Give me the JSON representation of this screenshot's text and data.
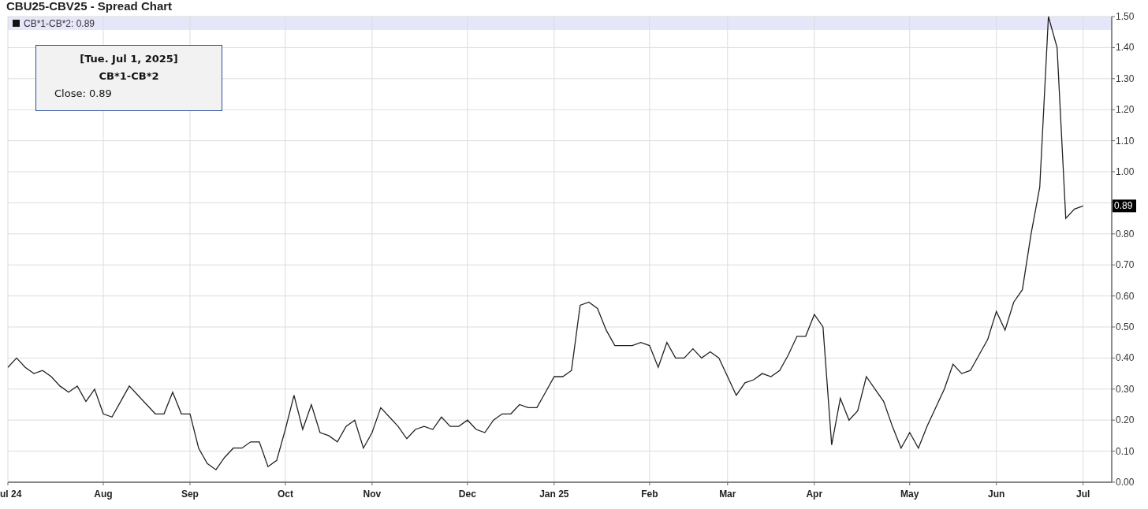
{
  "title": "CBU25-CBV25 - Spread Chart",
  "legend": {
    "label": "CB*1-CB*2: 0.89"
  },
  "tooltip": {
    "date": "[Tue. Jul 1, 2025]",
    "close": "Close: 0.89"
  },
  "last_value": "0.89",
  "chart_data": {
    "type": "line",
    "ylim": [
      0,
      1.5
    ],
    "grid": true,
    "categories": [
      "ul 24",
      null,
      null,
      null,
      null,
      null,
      null,
      null,
      null,
      null,
      null,
      "Aug",
      null,
      null,
      null,
      null,
      null,
      null,
      null,
      null,
      null,
      "Sep",
      null,
      null,
      null,
      null,
      null,
      null,
      null,
      null,
      null,
      null,
      "Oct",
      null,
      null,
      null,
      null,
      null,
      null,
      null,
      null,
      null,
      "Nov",
      null,
      null,
      null,
      null,
      null,
      null,
      null,
      null,
      null,
      null,
      "Dec",
      null,
      null,
      null,
      null,
      null,
      null,
      null,
      null,
      null,
      "Jan 25",
      null,
      null,
      null,
      null,
      null,
      null,
      null,
      null,
      null,
      null,
      "Feb",
      null,
      null,
      null,
      null,
      null,
      null,
      null,
      null,
      "Mar",
      null,
      null,
      null,
      null,
      null,
      null,
      null,
      null,
      null,
      "Apr",
      null,
      null,
      null,
      null,
      null,
      null,
      null,
      null,
      null,
      null,
      "May",
      null,
      null,
      null,
      null,
      null,
      null,
      null,
      null,
      null,
      "Jun",
      null,
      null,
      null,
      null,
      null,
      null,
      null,
      null,
      null,
      "Jul"
    ],
    "yticks": [
      {
        "value": 0,
        "label": "0.00"
      },
      {
        "value": 0.1,
        "label": "0.10"
      },
      {
        "value": 0.2,
        "label": "0.20"
      },
      {
        "value": 0.3,
        "label": "0.30"
      },
      {
        "value": 0.4,
        "label": "0.40"
      },
      {
        "value": 0.5,
        "label": "0.50"
      },
      {
        "value": 0.6,
        "label": "0.60"
      },
      {
        "value": 0.7,
        "label": "0.70"
      },
      {
        "value": 0.8,
        "label": "0.80"
      },
      {
        "value": 1.0,
        "label": "1.00"
      },
      {
        "value": 1.1,
        "label": "1.10"
      },
      {
        "value": 1.2,
        "label": "1.20"
      },
      {
        "value": 1.3,
        "label": "1.30"
      },
      {
        "value": 1.4,
        "label": "1.40"
      },
      {
        "value": 1.5,
        "label": "1.50"
      }
    ],
    "series": [
      {
        "name": "CB*1-CB*2",
        "color": "#222222",
        "values": [
          0.37,
          0.4,
          0.37,
          0.35,
          0.36,
          0.34,
          0.31,
          0.29,
          0.31,
          0.26,
          0.3,
          0.22,
          0.21,
          0.26,
          0.31,
          0.28,
          0.25,
          0.22,
          0.22,
          0.29,
          0.22,
          0.22,
          0.11,
          0.06,
          0.04,
          0.08,
          0.11,
          0.11,
          0.13,
          0.13,
          0.05,
          0.07,
          0.17,
          0.28,
          0.17,
          0.25,
          0.16,
          0.15,
          0.13,
          0.18,
          0.2,
          0.11,
          0.16,
          0.24,
          0.21,
          0.18,
          0.14,
          0.17,
          0.18,
          0.17,
          0.21,
          0.18,
          0.18,
          0.2,
          0.17,
          0.16,
          0.2,
          0.22,
          0.22,
          0.25,
          0.24,
          0.24,
          0.29,
          0.34,
          0.34,
          0.36,
          0.57,
          0.58,
          0.56,
          0.49,
          0.44,
          0.44,
          0.44,
          0.45,
          0.44,
          0.37,
          0.45,
          0.4,
          0.4,
          0.43,
          0.4,
          0.42,
          0.4,
          0.34,
          0.28,
          0.32,
          0.33,
          0.35,
          0.34,
          0.36,
          0.41,
          0.47,
          0.47,
          0.54,
          0.5,
          0.12,
          0.27,
          0.2,
          0.23,
          0.34,
          0.3,
          0.26,
          0.18,
          0.11,
          0.16,
          0.11,
          0.18,
          0.24,
          0.3,
          0.38,
          0.35,
          0.36,
          0.41,
          0.46,
          0.55,
          0.49,
          0.58,
          0.62,
          0.8,
          0.95,
          1.5,
          1.4,
          0.85,
          0.88,
          0.89
        ]
      }
    ]
  }
}
